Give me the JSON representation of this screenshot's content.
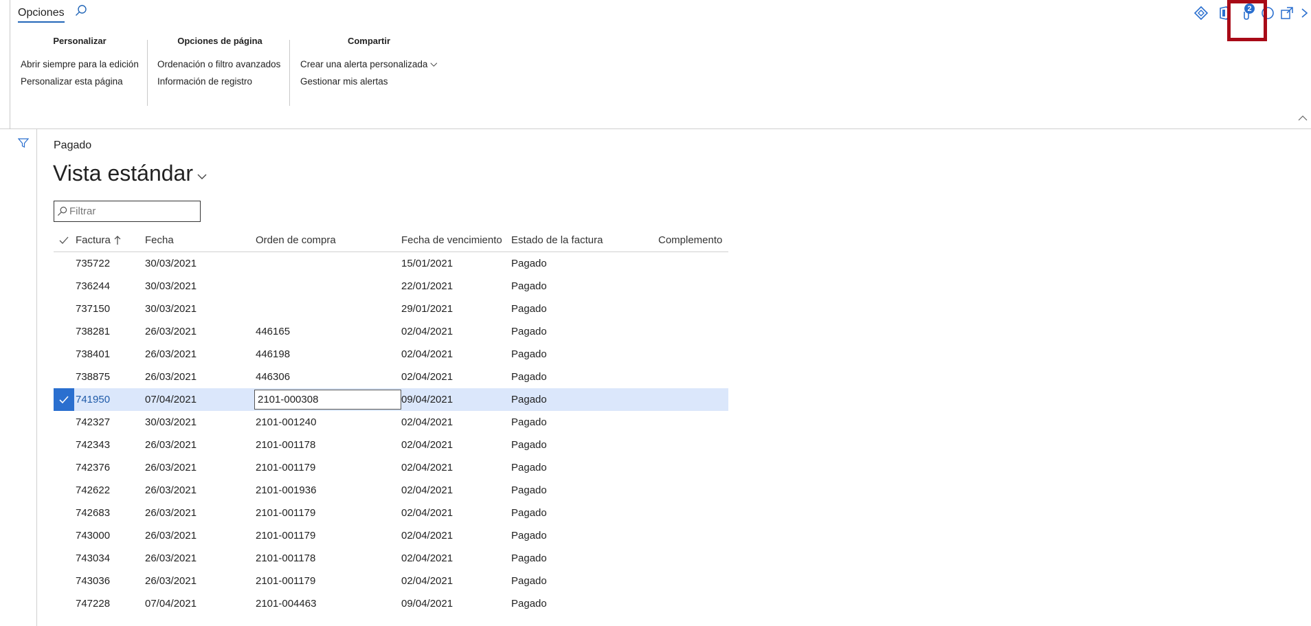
{
  "ribbon": {
    "tab_label": "Opciones",
    "groups": [
      {
        "title": "Personalizar",
        "items": [
          "Abrir siempre para la edición",
          "Personalizar esta página"
        ]
      },
      {
        "title": "Opciones de página",
        "items": [
          "Ordenación o filtro avanzados",
          "Información de registro"
        ]
      },
      {
        "title": "Compartir",
        "items": [
          "Crear una alerta personalizada",
          "Gestionar mis alertas"
        ]
      }
    ],
    "toolbar": {
      "icons": [
        "diamond-icon",
        "office-icon",
        "attachment-icon",
        "info-icon",
        "open-new-window-icon",
        "close-icon"
      ],
      "attachment_count": "2",
      "highlight_color": "#a80a17"
    }
  },
  "page": {
    "caption": "Pagado",
    "view_name": "Vista estándar",
    "filter_placeholder": "Filtrar"
  },
  "grid": {
    "columns": [
      "Factura",
      "Fecha",
      "Orden de compra",
      "Fecha de vencimiento",
      "Estado de la factura",
      "Complemento"
    ],
    "sort_column": "Factura",
    "sort_direction": "ascending",
    "selected_row": 6,
    "rows": [
      {
        "factura": "735722",
        "fecha": "30/03/2021",
        "orden": "",
        "vencimiento": "15/01/2021",
        "estado": "Pagado",
        "complemento": ""
      },
      {
        "factura": "736244",
        "fecha": "30/03/2021",
        "orden": "",
        "vencimiento": "22/01/2021",
        "estado": "Pagado",
        "complemento": ""
      },
      {
        "factura": "737150",
        "fecha": "30/03/2021",
        "orden": "",
        "vencimiento": "29/01/2021",
        "estado": "Pagado",
        "complemento": ""
      },
      {
        "factura": "738281",
        "fecha": "26/03/2021",
        "orden": "446165",
        "vencimiento": "02/04/2021",
        "estado": "Pagado",
        "complemento": ""
      },
      {
        "factura": "738401",
        "fecha": "26/03/2021",
        "orden": "446198",
        "vencimiento": "02/04/2021",
        "estado": "Pagado",
        "complemento": ""
      },
      {
        "factura": "738875",
        "fecha": "26/03/2021",
        "orden": "446306",
        "vencimiento": "02/04/2021",
        "estado": "Pagado",
        "complemento": ""
      },
      {
        "factura": "741950",
        "fecha": "07/04/2021",
        "orden": "2101-000308",
        "vencimiento": "09/04/2021",
        "estado": "Pagado",
        "complemento": ""
      },
      {
        "factura": "742327",
        "fecha": "30/03/2021",
        "orden": "2101-001240",
        "vencimiento": "02/04/2021",
        "estado": "Pagado",
        "complemento": ""
      },
      {
        "factura": "742343",
        "fecha": "26/03/2021",
        "orden": "2101-001178",
        "vencimiento": "02/04/2021",
        "estado": "Pagado",
        "complemento": ""
      },
      {
        "factura": "742376",
        "fecha": "26/03/2021",
        "orden": "2101-001179",
        "vencimiento": "02/04/2021",
        "estado": "Pagado",
        "complemento": ""
      },
      {
        "factura": "742622",
        "fecha": "26/03/2021",
        "orden": "2101-001936",
        "vencimiento": "02/04/2021",
        "estado": "Pagado",
        "complemento": ""
      },
      {
        "factura": "742683",
        "fecha": "26/03/2021",
        "orden": "2101-001179",
        "vencimiento": "02/04/2021",
        "estado": "Pagado",
        "complemento": ""
      },
      {
        "factura": "743000",
        "fecha": "26/03/2021",
        "orden": "2101-001179",
        "vencimiento": "02/04/2021",
        "estado": "Pagado",
        "complemento": ""
      },
      {
        "factura": "743034",
        "fecha": "26/03/2021",
        "orden": "2101-001178",
        "vencimiento": "02/04/2021",
        "estado": "Pagado",
        "complemento": ""
      },
      {
        "factura": "743036",
        "fecha": "26/03/2021",
        "orden": "2101-001179",
        "vencimiento": "02/04/2021",
        "estado": "Pagado",
        "complemento": ""
      },
      {
        "factura": "747228",
        "fecha": "07/04/2021",
        "orden": "2101-004463",
        "vencimiento": "09/04/2021",
        "estado": "Pagado",
        "complemento": ""
      }
    ]
  },
  "colors": {
    "accent": "#2a6fcf",
    "selected_row_bg": "#dbe7fb",
    "tab_underline": "#2266b8"
  }
}
